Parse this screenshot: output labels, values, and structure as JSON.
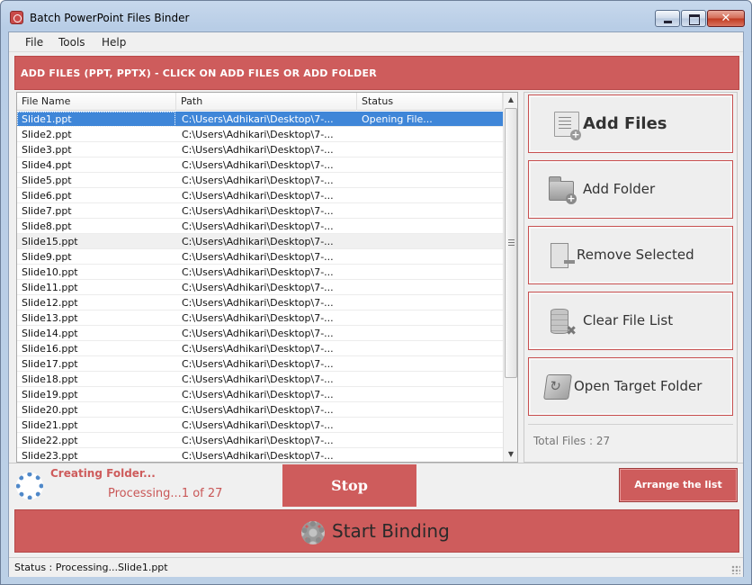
{
  "window": {
    "title": "Batch PowerPoint Files Binder"
  },
  "menu": [
    "File",
    "Tools",
    "Help"
  ],
  "header": {
    "instruction": "ADD FILES (PPT, PPTX) - CLICK ON ADD FILES OR ADD FOLDER"
  },
  "file_list": {
    "columns": [
      "File Name",
      "Path",
      "Status"
    ],
    "rows": [
      {
        "name": "Slide1.ppt",
        "path": "C:\\Users\\Adhikari\\Desktop\\7-...",
        "status": "Opening File..."
      },
      {
        "name": "Slide2.ppt",
        "path": "C:\\Users\\Adhikari\\Desktop\\7-...",
        "status": ""
      },
      {
        "name": "Slide3.ppt",
        "path": "C:\\Users\\Adhikari\\Desktop\\7-...",
        "status": ""
      },
      {
        "name": "Slide4.ppt",
        "path": "C:\\Users\\Adhikari\\Desktop\\7-...",
        "status": ""
      },
      {
        "name": "Slide5.ppt",
        "path": "C:\\Users\\Adhikari\\Desktop\\7-...",
        "status": ""
      },
      {
        "name": "Slide6.ppt",
        "path": "C:\\Users\\Adhikari\\Desktop\\7-...",
        "status": ""
      },
      {
        "name": "Slide7.ppt",
        "path": "C:\\Users\\Adhikari\\Desktop\\7-...",
        "status": ""
      },
      {
        "name": "Slide8.ppt",
        "path": "C:\\Users\\Adhikari\\Desktop\\7-...",
        "status": ""
      },
      {
        "name": "Slide15.ppt",
        "path": "C:\\Users\\Adhikari\\Desktop\\7-...",
        "status": ""
      },
      {
        "name": "Slide9.ppt",
        "path": "C:\\Users\\Adhikari\\Desktop\\7-...",
        "status": ""
      },
      {
        "name": "Slide10.ppt",
        "path": "C:\\Users\\Adhikari\\Desktop\\7-...",
        "status": ""
      },
      {
        "name": "Slide11.ppt",
        "path": "C:\\Users\\Adhikari\\Desktop\\7-...",
        "status": ""
      },
      {
        "name": "Slide12.ppt",
        "path": "C:\\Users\\Adhikari\\Desktop\\7-...",
        "status": ""
      },
      {
        "name": "Slide13.ppt",
        "path": "C:\\Users\\Adhikari\\Desktop\\7-...",
        "status": ""
      },
      {
        "name": "Slide14.ppt",
        "path": "C:\\Users\\Adhikari\\Desktop\\7-...",
        "status": ""
      },
      {
        "name": "Slide16.ppt",
        "path": "C:\\Users\\Adhikari\\Desktop\\7-...",
        "status": ""
      },
      {
        "name": "Slide17.ppt",
        "path": "C:\\Users\\Adhikari\\Desktop\\7-...",
        "status": ""
      },
      {
        "name": "Slide18.ppt",
        "path": "C:\\Users\\Adhikari\\Desktop\\7-...",
        "status": ""
      },
      {
        "name": "Slide19.ppt",
        "path": "C:\\Users\\Adhikari\\Desktop\\7-...",
        "status": ""
      },
      {
        "name": "Slide20.ppt",
        "path": "C:\\Users\\Adhikari\\Desktop\\7-...",
        "status": ""
      },
      {
        "name": "Slide21.ppt",
        "path": "C:\\Users\\Adhikari\\Desktop\\7-...",
        "status": ""
      },
      {
        "name": "Slide22.ppt",
        "path": "C:\\Users\\Adhikari\\Desktop\\7-...",
        "status": ""
      },
      {
        "name": "Slide23.ppt",
        "path": "C:\\Users\\Adhikari\\Desktop\\7-...",
        "status": ""
      }
    ],
    "selected_row": 0,
    "highlighted_row": 8
  },
  "actions": {
    "add_files": "Add Files",
    "add_folder": "Add Folder",
    "remove_selected": "Remove Selected",
    "clear_file_list": "Clear File List",
    "open_target_folder": "Open Target Folder",
    "total_files": "Total Files : 27"
  },
  "progress": {
    "title": "Creating Folder...",
    "text": "Processing...1 of 27",
    "current": 1,
    "total": 27
  },
  "buttons": {
    "stop": "Stop",
    "arrange": "Arrange the list",
    "start_binding": "Start Binding"
  },
  "statusbar": {
    "text": "Status  :  Processing...Slide1.ppt"
  },
  "colors": {
    "accent": "#ce5c5c",
    "selection": "#3f86d8"
  },
  "icons": {
    "add_files": "document-add-icon",
    "add_folder": "folder-add-icon",
    "remove_selected": "remove-icon",
    "clear_file_list": "clear-list-icon",
    "open_target_folder": "open-folder-icon",
    "start_binding": "gear-icon"
  }
}
